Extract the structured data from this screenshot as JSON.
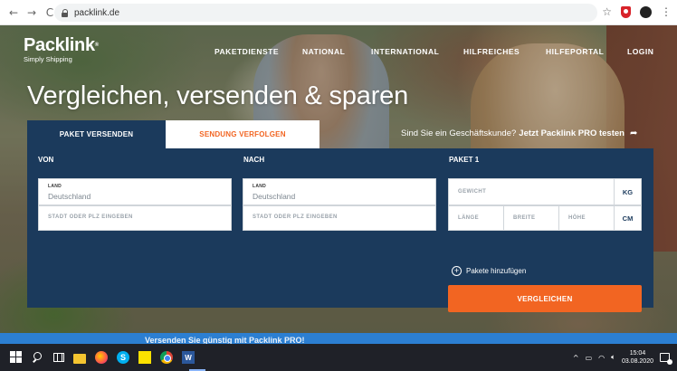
{
  "browser": {
    "url": "packlink.de",
    "back_icon": "arrow-left-icon",
    "forward_icon": "arrow-right-icon",
    "reload_icon": "reload-icon"
  },
  "site": {
    "logo": "Packlink",
    "logo_mark": "®",
    "tagline": "Simply Shipping",
    "nav": [
      "PAKETDIENSTE",
      "NATIONAL",
      "INTERNATIONAL",
      "HILFREICHES",
      "HILFEPORTAL",
      "LOGIN"
    ],
    "hero_title": "Vergleichen, versenden & sparen",
    "tabs": {
      "send": "PAKET VERSENDEN",
      "track": "SENDUNG VERFOLGEN"
    },
    "pro": {
      "question": "Sind Sie ein Geschäftskunde?",
      "link": "Jetzt Packlink PRO testen"
    },
    "form": {
      "from": {
        "heading": "VON",
        "country_label": "LAND",
        "country_value": "Deutschland",
        "city_placeholder": "STADT ODER PLZ EINGEBEN"
      },
      "to": {
        "heading": "NACH",
        "country_label": "LAND",
        "country_value": "Deutschland",
        "city_placeholder": "STADT ODER PLZ EINGEBEN"
      },
      "package": {
        "heading": "PAKET 1",
        "weight_placeholder": "GEWICHT",
        "weight_unit": "KG",
        "length_placeholder": "LÄNGE",
        "width_placeholder": "BREITE",
        "height_placeholder": "HÖHE",
        "dim_unit": "CM"
      },
      "add_package": "Pakete hinzufügen",
      "compare_button": "VERGLEICHEN"
    },
    "footer_text": "Versenden Sie günstig mit Packlink PRO!"
  },
  "colors": {
    "navy": "#1b3a5c",
    "orange": "#f26522",
    "taskbar": "#1f2128"
  },
  "taskbar": {
    "apps": [
      "windows-start-icon",
      "search-icon",
      "task-view-icon",
      "file-explorer-icon",
      "firefox-icon",
      "skype-icon",
      "sticky-notes-icon",
      "chrome-icon",
      "word-icon"
    ],
    "time": "15:04",
    "date": "03.08.2020"
  }
}
